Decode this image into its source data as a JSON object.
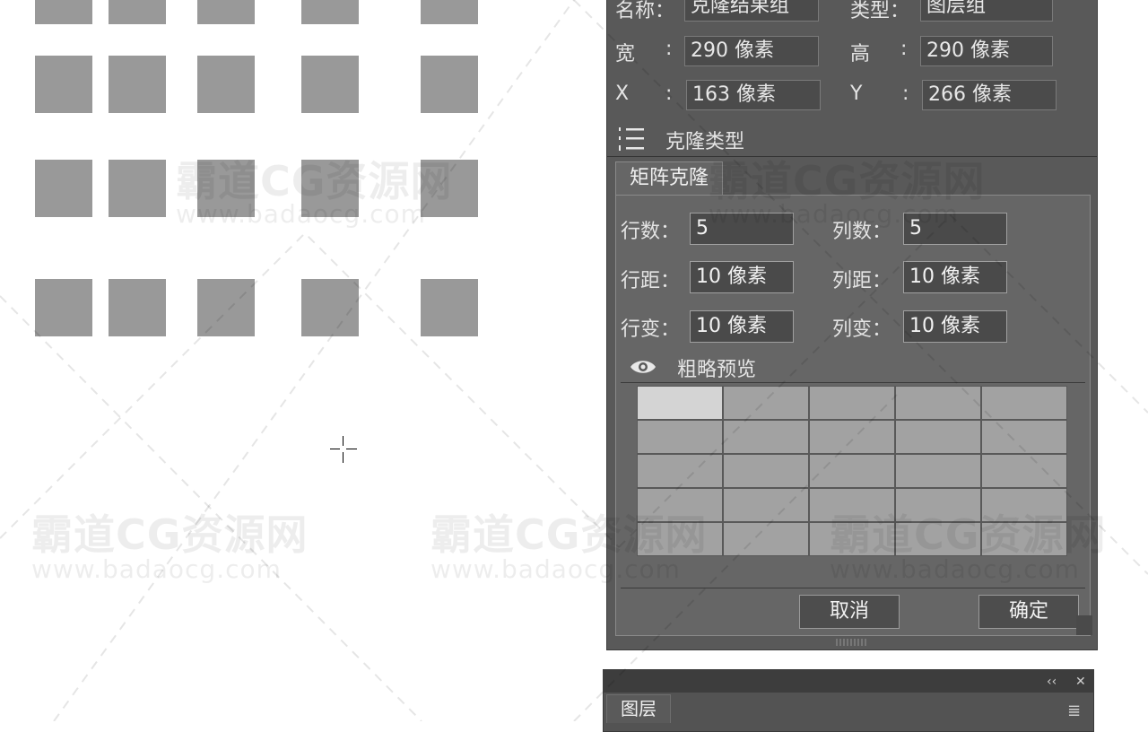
{
  "properties": {
    "name_label": "名称：",
    "name_value": "克隆结果组",
    "type_label": "类型：",
    "type_value": "图层组",
    "width_label": "宽",
    "width_value": "290 像素",
    "height_label": "高",
    "height_value": "290 像素",
    "x_label": "X",
    "x_value": "163 像素",
    "y_label": "Y",
    "y_value": "266 像素",
    "colon": ":"
  },
  "clone": {
    "section_title": "克隆类型",
    "tab_label": "矩阵克隆",
    "rows_label": "行数：",
    "rows_value": "5",
    "cols_label": "列数：",
    "cols_value": "5",
    "row_gap_label": "行距：",
    "row_gap_value": "10 像素",
    "col_gap_label": "列距：",
    "col_gap_value": "10 像素",
    "row_var_label": "行变：",
    "row_var_value": "10 像素",
    "col_var_label": "列变：",
    "col_var_value": "10 像素",
    "preview_label": "粗略预览",
    "cancel_label": "取消",
    "ok_label": "确定"
  },
  "layers_panel": {
    "tab_label": "图层",
    "collapse_glyph": "‹‹",
    "close_glyph": "✕",
    "menu_glyph": "≣"
  },
  "watermark": {
    "brand": "霸道CG资源网",
    "url": "www.badaocg.com"
  },
  "colors": {
    "panel_bg": "#595959",
    "field_bg": "#4b4b4b",
    "shape_fill": "#999999",
    "preview_selected": "#d4d4d4"
  }
}
